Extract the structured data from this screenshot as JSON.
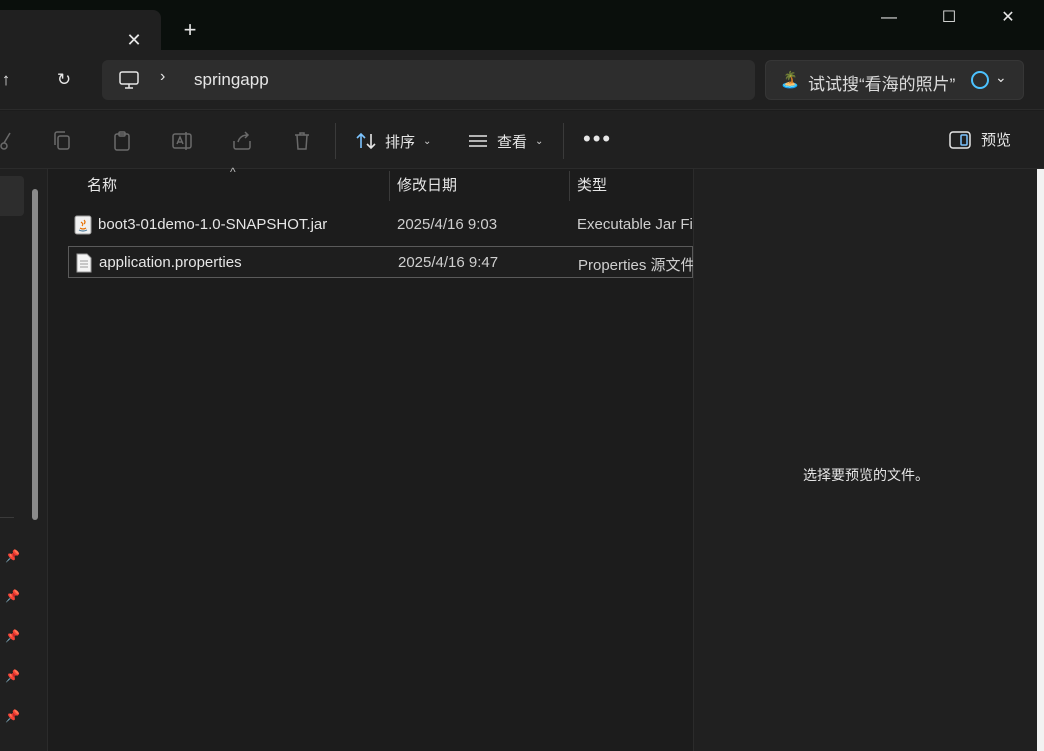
{
  "window": {
    "tab_close": "✕",
    "tab_new": "+",
    "minimize": "—",
    "maximize": "☐",
    "close": "✕"
  },
  "nav": {
    "up": "↑",
    "refresh": "↻",
    "breadcrumb_sep": "›",
    "path": "springapp"
  },
  "search": {
    "emoji": "🏝️",
    "text": "试试搜“看海的照片”",
    "chevron": "⌄"
  },
  "toolbar": {
    "sort_label": "排序",
    "view_label": "查看",
    "more_label": "•••",
    "preview_label": "预览",
    "chev": "⌄"
  },
  "columns": {
    "name": "名称",
    "date": "修改日期",
    "type": "类型",
    "sort_caret": "^"
  },
  "files": [
    {
      "name": "boot3-01demo-1.0-SNAPSHOT.jar",
      "date": "2025/4/16 9:03",
      "type": "Executable Jar File"
    },
    {
      "name": "application.properties",
      "date": "2025/4/16 9:47",
      "type": "Properties 源文件"
    }
  ],
  "preview_pane": {
    "message": "选择要预览的文件。"
  },
  "colors": {
    "accent": "#4cc2ff",
    "background": "#1c1c1c",
    "panel": "#202020"
  }
}
